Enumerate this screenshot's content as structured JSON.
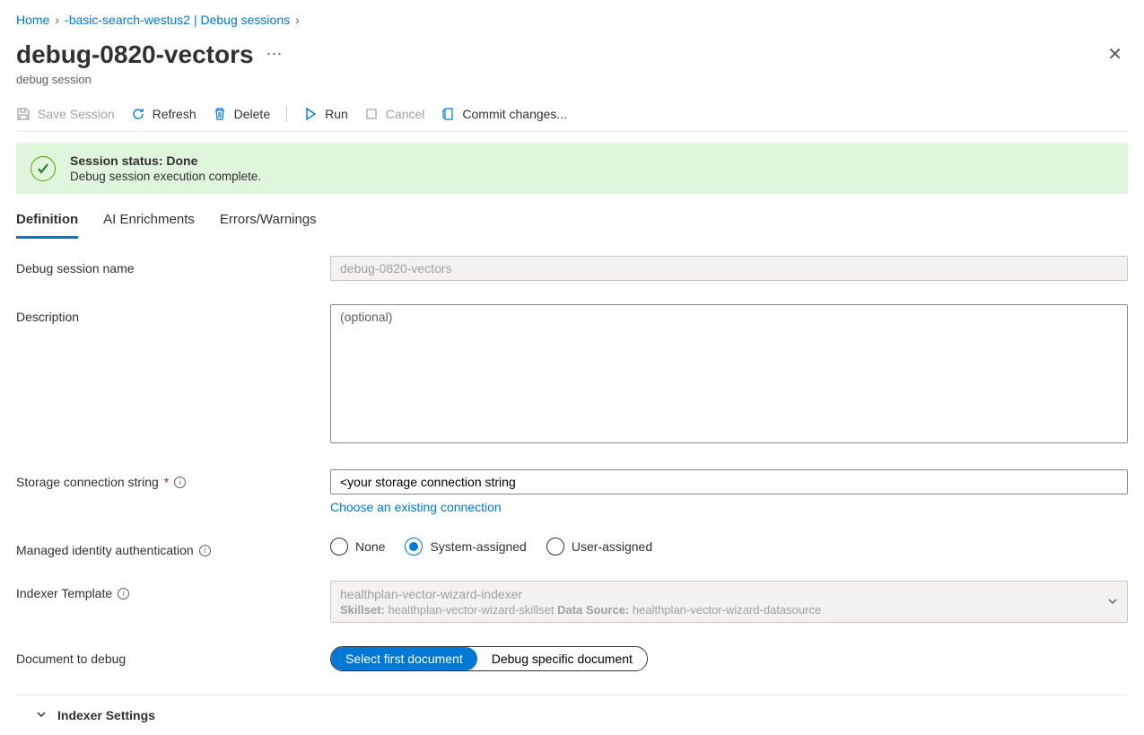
{
  "breadcrumb": {
    "home": "Home",
    "service": "-basic-search-westus2 | Debug sessions"
  },
  "page": {
    "title": "debug-0820-vectors",
    "subtitle": "debug session"
  },
  "toolbar": {
    "save": "Save Session",
    "refresh": "Refresh",
    "delete": "Delete",
    "run": "Run",
    "cancel": "Cancel",
    "commit": "Commit changes..."
  },
  "status": {
    "title": "Session status: Done",
    "message": "Debug session execution complete."
  },
  "tabs": {
    "definition": "Definition",
    "ai": "AI Enrichments",
    "errors": "Errors/Warnings"
  },
  "form": {
    "name_label": "Debug session name",
    "name_value": "debug-0820-vectors",
    "desc_label": "Description",
    "desc_placeholder": "(optional)",
    "conn_label": "Storage connection string",
    "conn_value": "<your storage connection string",
    "conn_link": "Choose an existing connection",
    "mi_label": "Managed identity authentication",
    "mi_none": "None",
    "mi_system": "System-assigned",
    "mi_user": "User-assigned",
    "template_label": "Indexer Template",
    "template_name": "healthplan-vector-wizard-indexer",
    "template_skillset_label": "Skillset:",
    "template_skillset_value": "healthplan-vector-wizard-skillset",
    "template_ds_label": "Data Source:",
    "template_ds_value": "healthplan-vector-wizard-datasource",
    "doc_label": "Document to debug",
    "doc_first": "Select first document",
    "doc_specific": "Debug specific document",
    "indexer_settings": "Indexer Settings"
  }
}
